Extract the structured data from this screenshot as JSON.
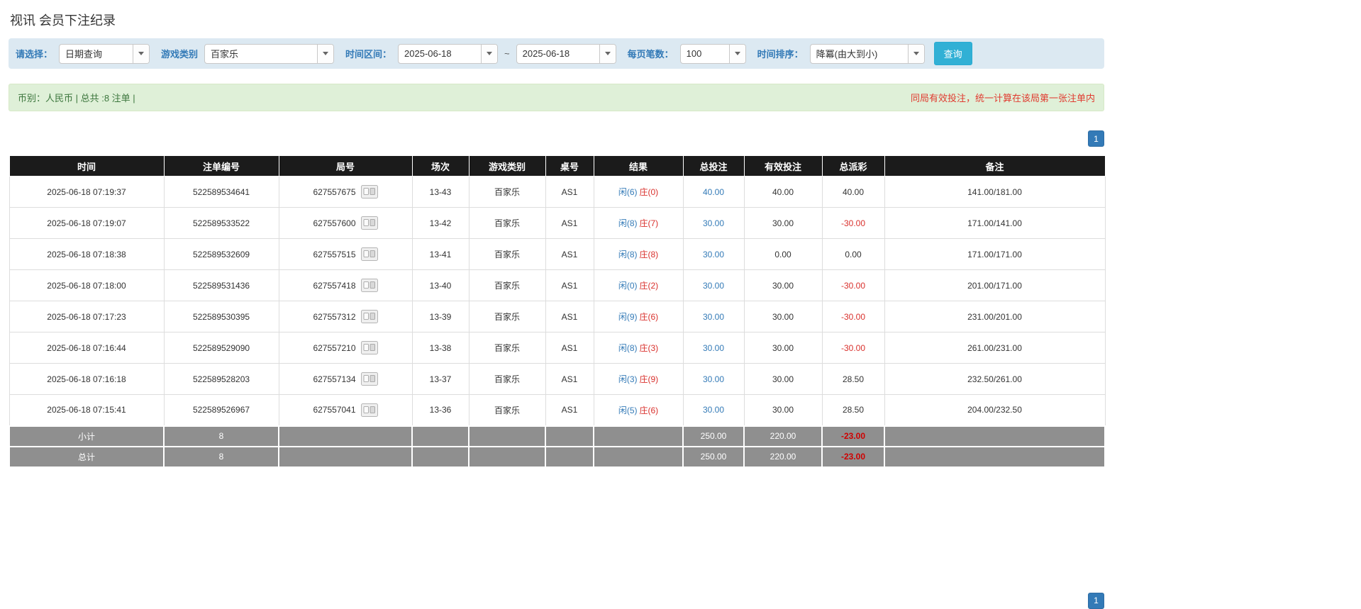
{
  "page": {
    "title": "视讯 会员下注纪录"
  },
  "filters": {
    "select_label": "请选择：",
    "select_value": "日期查询",
    "game_type_label": "游戏类别",
    "game_type_value": "百家乐",
    "date_range_label": "时间区间：",
    "date_from": "2025-06-18",
    "date_separator": "~",
    "date_to": "2025-06-18",
    "page_size_label": "每页笔数：",
    "page_size_value": "100",
    "sort_label": "时间排序：",
    "sort_value": "降冪(由大到小)",
    "search_button_label": "查询"
  },
  "summary": {
    "left_text": "币别：人民币 | 总共 :8 注单 |",
    "right_text": "同局有效投注，统一计算在该局第一张注单内"
  },
  "pagination": {
    "current_page": "1"
  },
  "icons": {
    "round_result_icon": "cards",
    "dropdown_caret_icon": "chevron-down"
  },
  "colors": {
    "accent_blue": "#337ab7",
    "header_black": "#1b1b1b",
    "footer_gray": "#8f8f8f",
    "success_green_bg": "#dff0d8",
    "negative_red": "#d9302c",
    "search_button_blue": "#31b0d5"
  },
  "table": {
    "headers": [
      "时间",
      "注单编号",
      "局号",
      "场次",
      "游戏类别",
      "桌号",
      "结果",
      "总投注",
      "有效投注",
      "总派彩",
      "备注"
    ],
    "rows": [
      {
        "time": "2025-06-18 07:19:37",
        "bet_id": "522589534641",
        "round": "627557675",
        "session": "13-43",
        "game": "百家乐",
        "table_no": "AS1",
        "player": "闲(6)",
        "banker": "庄(0)",
        "total_bet": "40.00",
        "valid_bet": "40.00",
        "payout": "40.00",
        "remark": "141.00/181.00"
      },
      {
        "time": "2025-06-18 07:19:07",
        "bet_id": "522589533522",
        "round": "627557600",
        "session": "13-42",
        "game": "百家乐",
        "table_no": "AS1",
        "player": "闲(8)",
        "banker": "庄(7)",
        "total_bet": "30.00",
        "valid_bet": "30.00",
        "payout": "-30.00",
        "remark": "171.00/141.00"
      },
      {
        "time": "2025-06-18 07:18:38",
        "bet_id": "522589532609",
        "round": "627557515",
        "session": "13-41",
        "game": "百家乐",
        "table_no": "AS1",
        "player": "闲(8)",
        "banker": "庄(8)",
        "total_bet": "30.00",
        "valid_bet": "0.00",
        "payout": "0.00",
        "remark": "171.00/171.00"
      },
      {
        "time": "2025-06-18 07:18:00",
        "bet_id": "522589531436",
        "round": "627557418",
        "session": "13-40",
        "game": "百家乐",
        "table_no": "AS1",
        "player": "闲(0)",
        "banker": "庄(2)",
        "total_bet": "30.00",
        "valid_bet": "30.00",
        "payout": "-30.00",
        "remark": "201.00/171.00"
      },
      {
        "time": "2025-06-18 07:17:23",
        "bet_id": "522589530395",
        "round": "627557312",
        "session": "13-39",
        "game": "百家乐",
        "table_no": "AS1",
        "player": "闲(9)",
        "banker": "庄(6)",
        "total_bet": "30.00",
        "valid_bet": "30.00",
        "payout": "-30.00",
        "remark": "231.00/201.00"
      },
      {
        "time": "2025-06-18 07:16:44",
        "bet_id": "522589529090",
        "round": "627557210",
        "session": "13-38",
        "game": "百家乐",
        "table_no": "AS1",
        "player": "闲(8)",
        "banker": "庄(3)",
        "total_bet": "30.00",
        "valid_bet": "30.00",
        "payout": "-30.00",
        "remark": "261.00/231.00"
      },
      {
        "time": "2025-06-18 07:16:18",
        "bet_id": "522589528203",
        "round": "627557134",
        "session": "13-37",
        "game": "百家乐",
        "table_no": "AS1",
        "player": "闲(3)",
        "banker": "庄(9)",
        "total_bet": "30.00",
        "valid_bet": "30.00",
        "payout": "28.50",
        "remark": "232.50/261.00"
      },
      {
        "time": "2025-06-18 07:15:41",
        "bet_id": "522589526967",
        "round": "627557041",
        "session": "13-36",
        "game": "百家乐",
        "table_no": "AS1",
        "player": "闲(5)",
        "banker": "庄(6)",
        "total_bet": "30.00",
        "valid_bet": "30.00",
        "payout": "28.50",
        "remark": "204.00/232.50"
      }
    ],
    "subtotal": {
      "label": "小计",
      "count": "8",
      "total_bet": "250.00",
      "valid_bet": "220.00",
      "payout": "-23.00"
    },
    "grand_total": {
      "label": "总计",
      "count": "8",
      "total_bet": "250.00",
      "valid_bet": "220.00",
      "payout": "-23.00"
    }
  }
}
